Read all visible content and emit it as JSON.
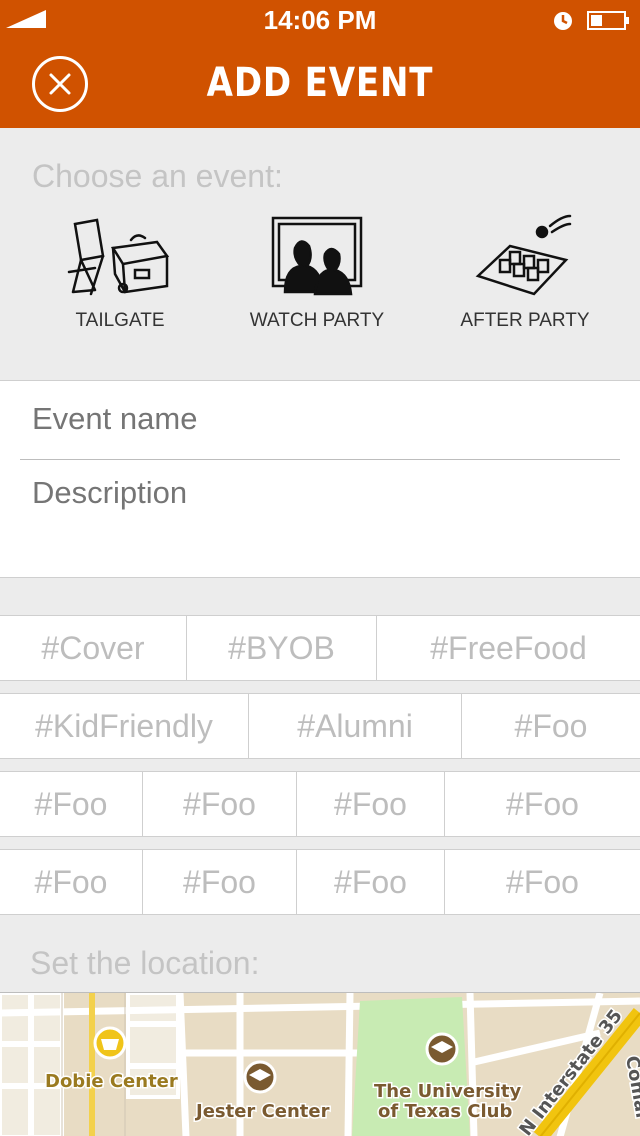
{
  "status_bar": {
    "time": "14:06 PM"
  },
  "header": {
    "title": "ADD EVENT"
  },
  "choose": {
    "label": "Choose an event:",
    "types": [
      {
        "label": "TAILGATE",
        "icon": "tailgate-icon"
      },
      {
        "label": "WATCH PARTY",
        "icon": "watch-party-icon"
      },
      {
        "label": "AFTER PARTY",
        "icon": "after-party-icon"
      }
    ]
  },
  "form": {
    "event_name": {
      "placeholder": "Event name",
      "value": ""
    },
    "description": {
      "placeholder": "Description",
      "value": ""
    }
  },
  "tags": {
    "row1": [
      "#Cover",
      "#BYOB",
      "#FreeFood"
    ],
    "row2": [
      "#KidFriendly",
      "#Alumni",
      "#Foo"
    ],
    "row3": [
      "#Foo",
      "#Foo",
      "#Foo",
      "#Foo"
    ],
    "row4": [
      "#Foo",
      "#Foo",
      "#Foo",
      "#Foo"
    ]
  },
  "location": {
    "label": "Set the location:",
    "map_labels": {
      "dobie": "Dobie Center",
      "jester": "Jester Center",
      "club_line1": "The University",
      "club_line2": "of Texas Club",
      "interstate": "N Interstate 35",
      "street": "Comal"
    }
  },
  "colors": {
    "accent": "#d05200",
    "background": "#ececec"
  }
}
